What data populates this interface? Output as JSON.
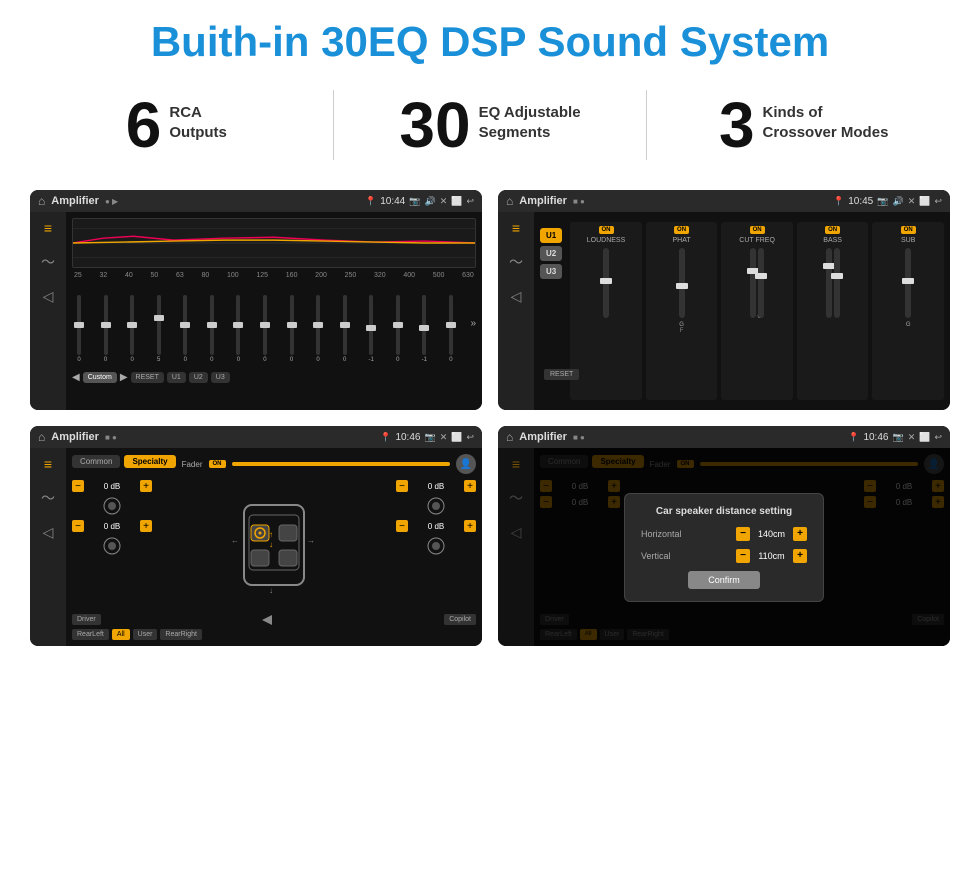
{
  "header": {
    "title": "Buith-in 30EQ DSP Sound System"
  },
  "stats": [
    {
      "number": "6",
      "text_line1": "RCA",
      "text_line2": "Outputs"
    },
    {
      "number": "30",
      "text_line1": "EQ Adjustable",
      "text_line2": "Segments"
    },
    {
      "number": "3",
      "text_line1": "Kinds of",
      "text_line2": "Crossover Modes"
    }
  ],
  "screen1": {
    "status": {
      "title": "Amplifier",
      "time": "10:44"
    },
    "eq_freqs": [
      "25",
      "32",
      "40",
      "50",
      "63",
      "80",
      "100",
      "125",
      "160",
      "200",
      "250",
      "320",
      "400",
      "500",
      "630"
    ],
    "eq_values": [
      "0",
      "0",
      "0",
      "5",
      "0",
      "0",
      "0",
      "0",
      "0",
      "0",
      "0",
      "-1",
      "0",
      "-1"
    ],
    "bottom_btns": [
      "Custom",
      "RESET",
      "U1",
      "U2",
      "U3"
    ]
  },
  "screen2": {
    "status": {
      "title": "Amplifier",
      "time": "10:45"
    },
    "u_buttons": [
      "U1",
      "U2",
      "U3"
    ],
    "channels": [
      {
        "label": "LOUDNESS",
        "on": true
      },
      {
        "label": "PHAT",
        "on": true
      },
      {
        "label": "CUT FREQ",
        "on": true
      },
      {
        "label": "BASS",
        "on": true
      },
      {
        "label": "SUB",
        "on": true
      }
    ],
    "reset_label": "RESET"
  },
  "screen3": {
    "status": {
      "title": "Amplifier",
      "time": "10:46"
    },
    "tabs": [
      "Common",
      "Specialty"
    ],
    "active_tab": "Specialty",
    "fader_label": "Fader",
    "fader_on": "ON",
    "db_values": [
      "0 dB",
      "0 dB",
      "0 dB",
      "0 dB"
    ],
    "bottom_btns": [
      "Driver",
      "",
      "Copilot",
      "RearLeft",
      "All",
      "User",
      "RearRight"
    ]
  },
  "screen4": {
    "status": {
      "title": "Amplifier",
      "time": "10:46"
    },
    "tabs": [
      "Common",
      "Specialty"
    ],
    "dialog": {
      "title": "Car speaker distance setting",
      "horizontal_label": "Horizontal",
      "horizontal_value": "140cm",
      "vertical_label": "Vertical",
      "vertical_value": "110cm",
      "confirm_label": "Confirm"
    },
    "db_values": [
      "0 dB",
      "0 dB"
    ],
    "bottom_btns": [
      "Driver",
      "Copilot",
      "RearLeft",
      "User",
      "RearRight"
    ]
  }
}
